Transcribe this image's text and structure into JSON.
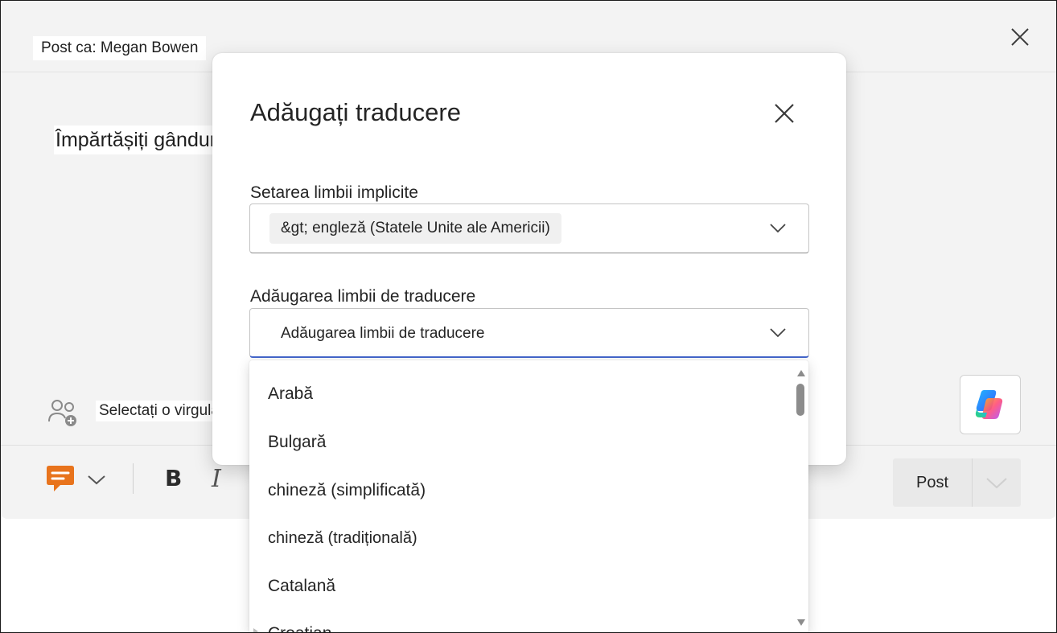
{
  "composer": {
    "post_as": "Post ca: Megan Bowen",
    "thoughts": "Împărtășiți gânduri",
    "mention": "Selectați o virgulă",
    "post_label": "Post"
  },
  "icons": {
    "close": "close-icon",
    "people": "add-people-icon",
    "copilot": "copilot-icon",
    "post_type": "chat-bubble-icon",
    "chevron": "chevron-down-icon"
  },
  "toolbar": {
    "bold": "B",
    "italic": "I"
  },
  "dialog": {
    "title": "Adăugați traducere",
    "default_label": "Setarea limbii implicite",
    "default_value": "&gt; engleză (Statele Unite ale Americii)",
    "translate_label": "Adăugarea limbii de traducere",
    "translate_placeholder": "Adăugarea limbii de traducere"
  },
  "languages": [
    "Arabă",
    "Bulgară",
    "chineză (simplificată)",
    "chineză (tradițională)",
    "Catalană",
    "Croatian"
  ],
  "colors": {
    "accent": "#4466cc",
    "post_type_icon": "#e8731c"
  }
}
